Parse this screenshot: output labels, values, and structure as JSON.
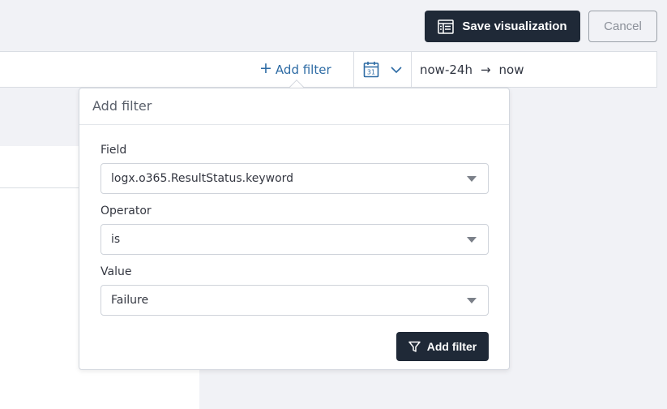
{
  "toolbar": {
    "save_label": "Save visualization",
    "cancel_label": "Cancel"
  },
  "query_bar": {
    "add_filter_label": "Add filter",
    "time_from": "now-24h",
    "time_arrow": "→",
    "time_to": "now"
  },
  "popover": {
    "title": "Add filter",
    "field": {
      "label": "Field",
      "value": "logx.o365.ResultStatus.keyword"
    },
    "operator": {
      "label": "Operator",
      "value": "is"
    },
    "value": {
      "label": "Value",
      "value": "Failure"
    },
    "submit_label": "Add filter"
  },
  "colors": {
    "primary_dark": "#1f2937",
    "link_blue": "#2d6ba4",
    "background": "#f1f2f6"
  },
  "icons": {
    "save": "table-icon",
    "calendar": "calendar-icon",
    "chevron": "chevron-down-icon",
    "submit": "filter-icon"
  }
}
